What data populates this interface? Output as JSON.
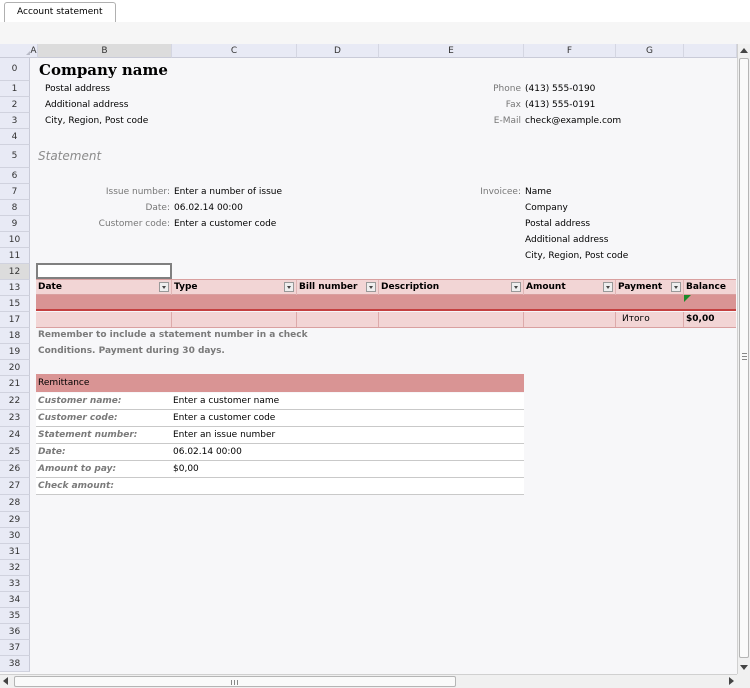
{
  "tab": {
    "label": "Account statement"
  },
  "columns": [
    "A",
    "B",
    "C",
    "D",
    "E",
    "F",
    "G"
  ],
  "rows": [
    "0",
    "1",
    "2",
    "3",
    "4",
    "5",
    "6",
    "7",
    "8",
    "9",
    "10",
    "11",
    "12",
    "13",
    "15",
    "17",
    "18",
    "19",
    "20",
    "21",
    "22",
    "23",
    "24",
    "25",
    "26",
    "27",
    "28",
    "29",
    "30",
    "31",
    "32",
    "33",
    "34",
    "35",
    "36",
    "37",
    "38"
  ],
  "company": {
    "name": "Company name",
    "postal": "Postal address",
    "additional": "Additional address",
    "city": "City, Region, Post code"
  },
  "contact": {
    "phone_label": "Phone",
    "phone": "(413) 555-0190",
    "fax_label": "Fax",
    "fax": "(413) 555-0191",
    "email_label": "E-Mail",
    "email": "check@example.com"
  },
  "statement": {
    "title": "Statement",
    "issue_label": "Issue number:",
    "issue": "Enter a number of issue",
    "date_label": "Date:",
    "date": "06.02.14 00:00",
    "cust_label": "Customer code:",
    "cust": "Enter a customer code",
    "invoicee_label": "Invoicee:",
    "invoicee": [
      "Name",
      "Company",
      "Postal address",
      "Additional address",
      "City, Region, Post code"
    ]
  },
  "table": {
    "headers": [
      "Date",
      "Type",
      "Bill number",
      "Description",
      "Amount",
      "Payment",
      "Balance"
    ],
    "total_label": "Итого",
    "total_value": "$0,00"
  },
  "notes": {
    "line1": "Remember to  include a statement number  in a check",
    "line2": "Conditions. Payment during 30 days."
  },
  "remittance": {
    "title": "Remittance",
    "rows": [
      {
        "label": "Customer name:",
        "value": "Enter a customer name"
      },
      {
        "label": "Customer code:",
        "value": "Enter a customer code"
      },
      {
        "label": "Statement number:",
        "value": "Enter an issue number"
      },
      {
        "label": "Date:",
        "value": "06.02.14 00:00"
      },
      {
        "label": "Amount to pay:",
        "value": "$0,00"
      },
      {
        "label": "Check amount:",
        "value": ""
      }
    ]
  },
  "colors": {
    "header_pink": "#f2d5d5",
    "accent_red": "#d99494",
    "line_red": "#c44040"
  }
}
